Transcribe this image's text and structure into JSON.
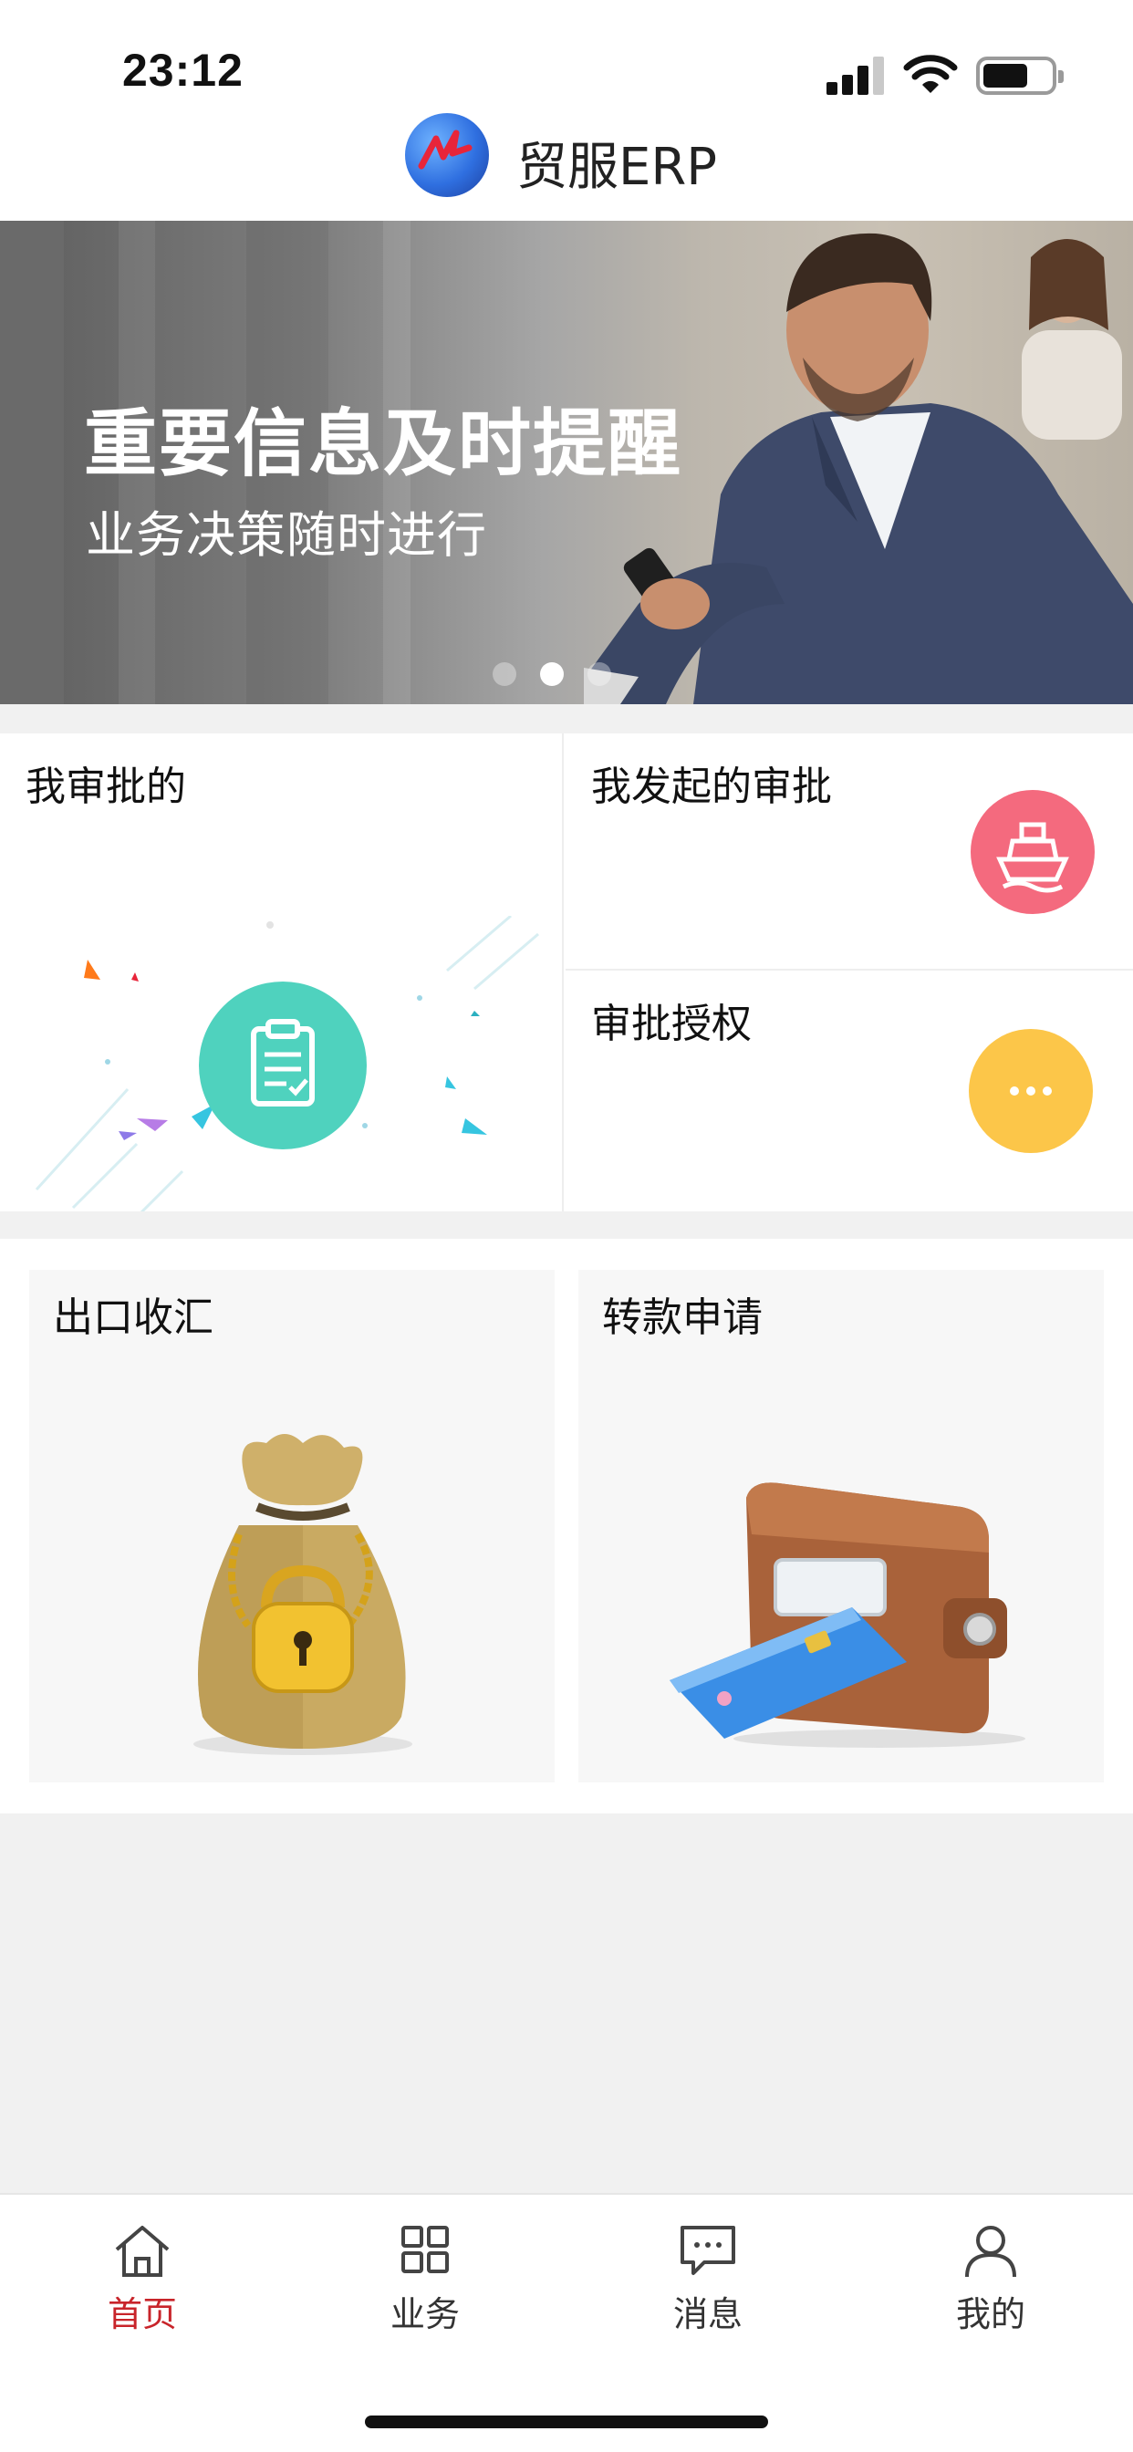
{
  "status_bar": {
    "time": "23:12"
  },
  "header": {
    "app_title": "贸服ERP"
  },
  "banner": {
    "title": "重要信息及时提醒",
    "subtitle": "业务决策随时进行",
    "slide_count": 3,
    "active_slide": 2
  },
  "approval": {
    "my_approvals": "我审批的",
    "my_initiated": "我发起的审批",
    "authorization": "审批授权"
  },
  "finance": {
    "export_collection": "出口收汇",
    "transfer_request": "转款申请"
  },
  "tabs": [
    {
      "label": "首页",
      "icon": "home-icon",
      "active": true
    },
    {
      "label": "业务",
      "icon": "grid-icon",
      "active": false
    },
    {
      "label": "消息",
      "icon": "message-icon",
      "active": false
    },
    {
      "label": "我的",
      "icon": "user-icon",
      "active": false
    }
  ],
  "colors": {
    "accent": "#c8242a",
    "approve_green": "#4fd2be",
    "initiated_pink": "#f46a7e",
    "authorization_yellow": "#fcc649"
  }
}
